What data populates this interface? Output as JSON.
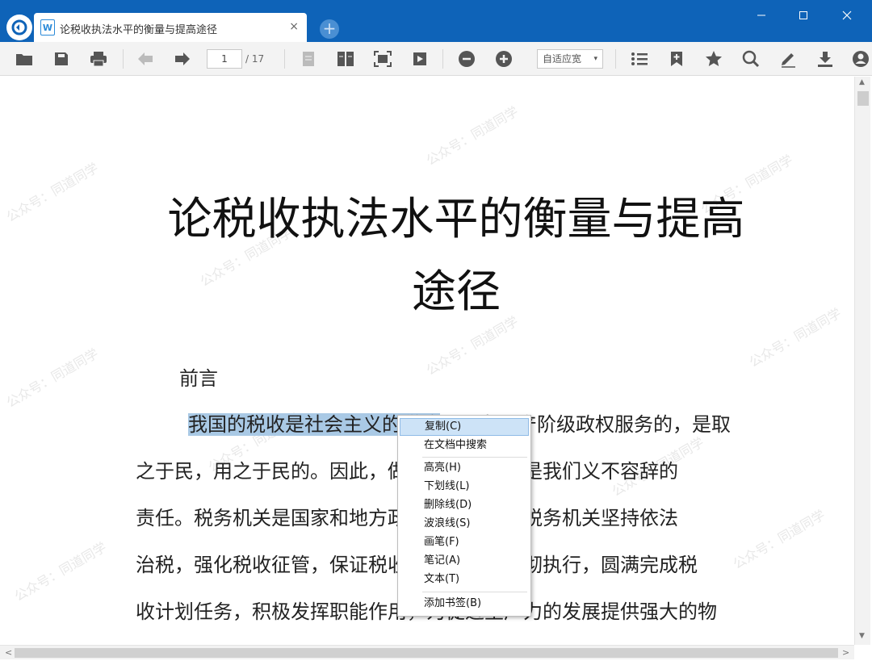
{
  "colors": {
    "titlebar": "#0e63b8",
    "toolbar": "#f3f3f3",
    "selection_highlight": "#a9c9e5",
    "menu_active": "#cde3f7",
    "icon": "#555555"
  },
  "tab": {
    "title": "论税收执法水平的衡量与提高途径",
    "doc_icon_letter": "W",
    "close_glyph": "×",
    "new_tab_glyph": "+"
  },
  "window": {
    "minimize_glyph": "—",
    "maximize_glyph": "☐",
    "close_glyph": "✕"
  },
  "toolbar": {
    "current_page": "1",
    "total_pages": "/ 17",
    "zoom_mode": "自适应宽",
    "zoom_arrow": "▾",
    "icons": [
      "open-folder-icon",
      "save-icon",
      "print-icon",
      "back-arrow-icon",
      "forward-arrow-icon",
      "single-page-icon",
      "double-page-icon",
      "fit-page-icon",
      "slideshow-icon",
      "zoom-out-icon",
      "zoom-in-icon",
      "outline-icon",
      "add-bookmark-icon",
      "star-icon",
      "search-icon",
      "annotate-pen-icon",
      "download-icon",
      "account-icon"
    ]
  },
  "document": {
    "title_line1": "论税收执法水平的衡量与提高",
    "title_line2": "途径",
    "heading": "前言",
    "para_line1_selected": "我国的税收是社会主义的税收",
    "para_line1_rest": "，是为无产阶级政权服务的，是取",
    "para_line2": "之于民，用之于民的。因此，做好税收工作，是我们义不容辞的",
    "para_line3": "责任。税务机关是国家和地方政府部门之一，税务机关坚持依法",
    "para_line4": "治税，强化税收征管，保证税收法规政策的贯彻执行，圆满完成税",
    "para_line5": "收计划任务，积极发挥职能作用，为促进生产力的发展提供强大的物",
    "watermark": "公众号：同道同学"
  },
  "context_menu": {
    "items": [
      {
        "label": "复制(C)"
      },
      {
        "label": "在文档中搜索"
      },
      {
        "label": "高亮(H)"
      },
      {
        "label": "下划线(L)"
      },
      {
        "label": "删除线(D)"
      },
      {
        "label": "波浪线(S)"
      },
      {
        "label": "画笔(F)"
      },
      {
        "label": "笔记(A)"
      },
      {
        "label": "文本(T)"
      },
      {
        "label": "添加书签(B)"
      }
    ]
  },
  "scrollbars": {
    "up_arrow": "▲",
    "down_arrow": "▼",
    "left_arrow": "<",
    "right_arrow": ">"
  }
}
